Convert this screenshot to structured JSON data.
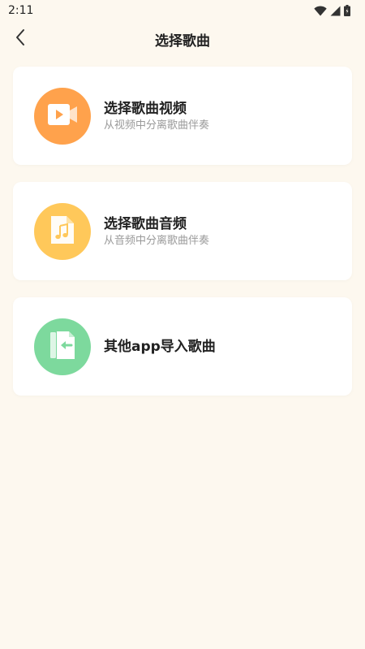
{
  "status_bar": {
    "time": "2:11",
    "icons": [
      "wifi-icon",
      "signal-icon",
      "battery-icon"
    ]
  },
  "header": {
    "title": "选择歌曲",
    "back_icon": "chevron-left-icon"
  },
  "options": [
    {
      "title": "选择歌曲视频",
      "subtitle": "从视频中分离歌曲伴奏",
      "icon": "video-file-icon",
      "color": "#ffa24c"
    },
    {
      "title": "选择歌曲音频",
      "subtitle": "从音频中分离歌曲伴奏",
      "icon": "music-file-icon",
      "color": "#ffc85a"
    },
    {
      "title": "其他app导入歌曲",
      "icon": "import-file-icon",
      "color": "#7dd99d"
    }
  ],
  "colors": {
    "background": "#fdf8ef",
    "card": "#ffffff",
    "title_text": "#222222",
    "subtitle_text": "#9a9a9a"
  }
}
